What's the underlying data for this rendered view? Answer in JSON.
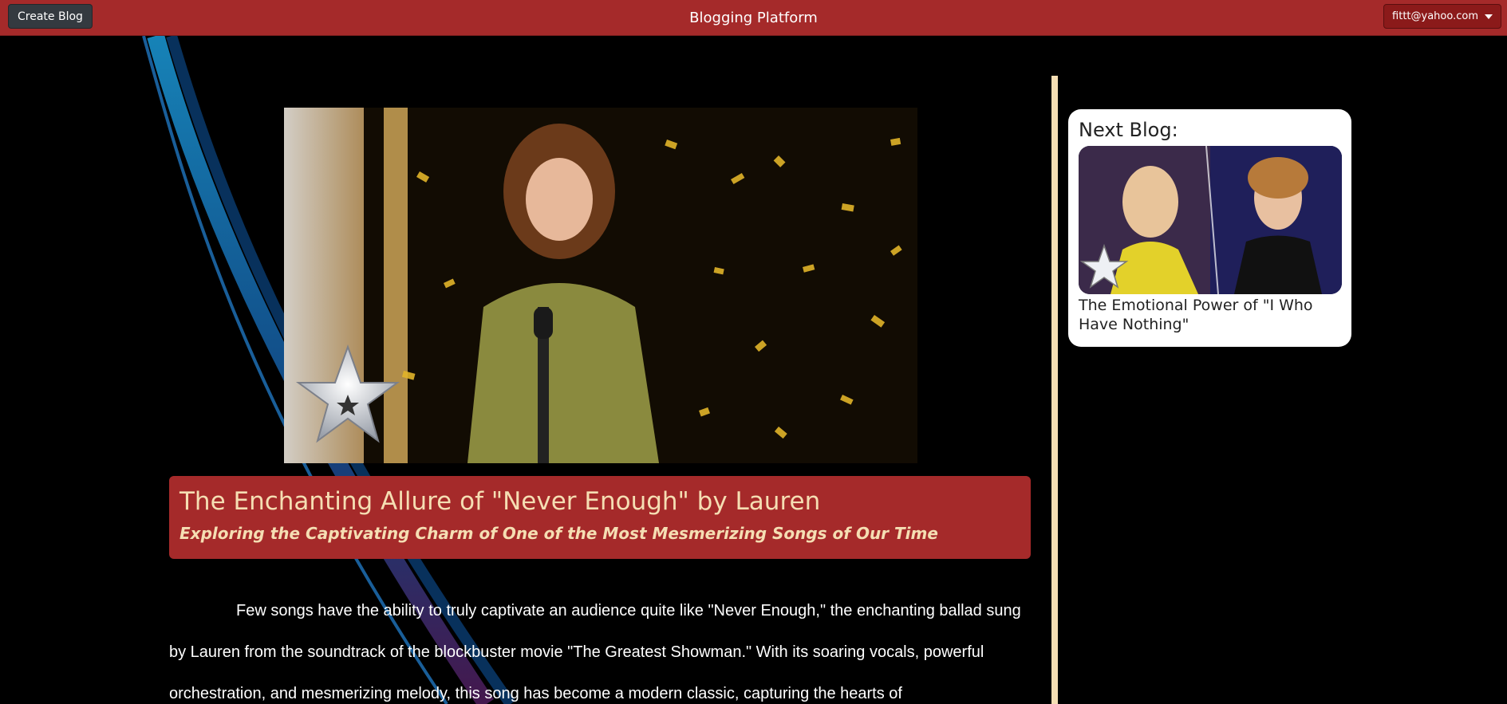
{
  "navbar": {
    "create_label": "Create Blog",
    "title": "Blogging Platform",
    "user_email": "fittt@yahoo.com"
  },
  "hero": {
    "icon": "star-logo-icon"
  },
  "post": {
    "title": "The Enchanting Allure of \"Never Enough\" by Lauren",
    "subtitle": "Exploring the Captivating Charm of One of the Most Mesmerizing Songs of Our Time",
    "body": "Few songs have the ability to truly captivate an audience quite like \"Never Enough,\" the enchanting ballad sung by Lauren from the soundtrack of the blockbuster movie \"The Greatest Showman.\" With its soaring vocals, powerful orchestration, and mesmerizing melody, this song has become a modern classic, capturing the hearts of"
  },
  "sidebar": {
    "heading": "Next Blog:",
    "next_title": "The Emotional Power of \"I Who Have Nothing\""
  },
  "colors": {
    "accent": "#a52a2a",
    "title_text": "#f5deb3",
    "divider": "#f5deb3",
    "dark_button": "#343a40"
  }
}
